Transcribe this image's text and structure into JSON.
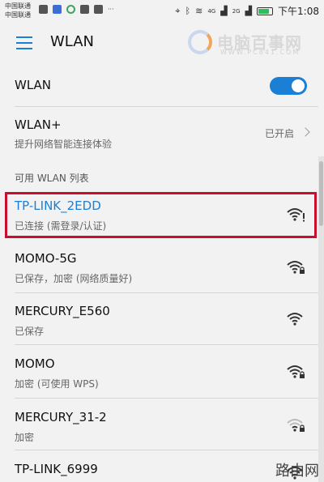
{
  "status_bar": {
    "carrier_1": "中国联通",
    "carrier_2": "中国联通",
    "signal_label_1": "4G",
    "signal_label_2": "2G",
    "time": "下午1:08"
  },
  "app_bar": {
    "title": "WLAN"
  },
  "watermark": {
    "brand": "电脑百事网",
    "url": "WWW.PC841.COM",
    "bottom": "路由网"
  },
  "settings": {
    "wlan": {
      "label": "WLAN",
      "enabled": true
    },
    "wlan_plus": {
      "label": "WLAN+",
      "subtitle": "提升网络智能连接体验",
      "status": "已开启"
    }
  },
  "section_header": "可用 WLAN 列表",
  "networks": [
    {
      "name": "TP-LINK_2EDD",
      "status": "已连接 (需登录/认证)",
      "icon": "wifi-alert-icon",
      "highlight": true
    },
    {
      "name": "MOMO-5G",
      "status": "已保存，加密 (网络质量好)",
      "icon": "wifi-lock-icon"
    },
    {
      "name": "MERCURY_E560",
      "status": "已保存",
      "icon": "wifi-icon"
    },
    {
      "name": "MOMO",
      "status": "加密 (可使用 WPS)",
      "icon": "wifi-lock-icon"
    },
    {
      "name": "MERCURY_31-2",
      "status": "加密",
      "icon": "wifi-lock-weak-icon"
    },
    {
      "name": "TP-LINK_6999",
      "status": "",
      "icon": "wifi-lock-icon"
    }
  ],
  "colors": {
    "accent": "#1b7fd6",
    "highlight_border": "#c8102e",
    "connected_text": "#1b7fd6"
  }
}
